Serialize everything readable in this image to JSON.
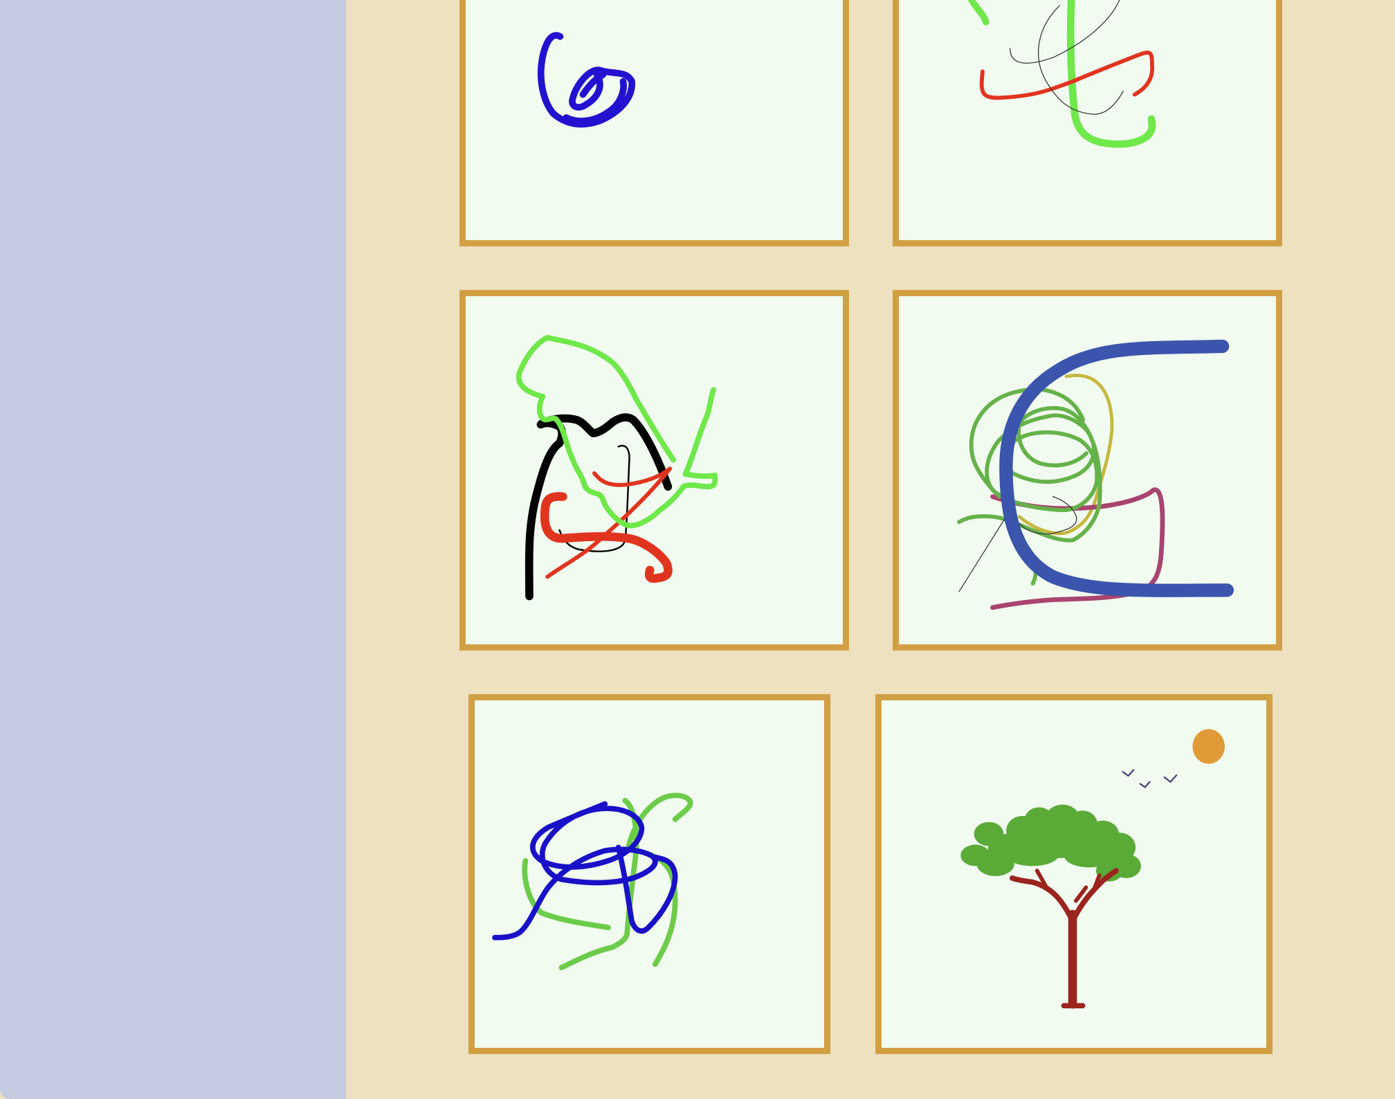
{
  "sidebar": {},
  "gallery": {
    "drawings": [
      {
        "id": "drawing-1",
        "description_icon": "blue-scribble-icon"
      },
      {
        "id": "drawing-2",
        "description_icon": "green-red-scribble-icon"
      },
      {
        "id": "drawing-3",
        "description_icon": "black-red-green-scribble-icon"
      },
      {
        "id": "drawing-4",
        "description_icon": "blue-arc-scribble-icon"
      },
      {
        "id": "drawing-5",
        "description_icon": "blue-green-tangle-icon"
      },
      {
        "id": "drawing-6",
        "description_icon": "tree-sun-birds-icon"
      }
    ]
  },
  "colors": {
    "sidebar": "#c4cae0",
    "background": "#ede1bf",
    "frame": "#d2a044",
    "canvas": "#f1fbef"
  }
}
